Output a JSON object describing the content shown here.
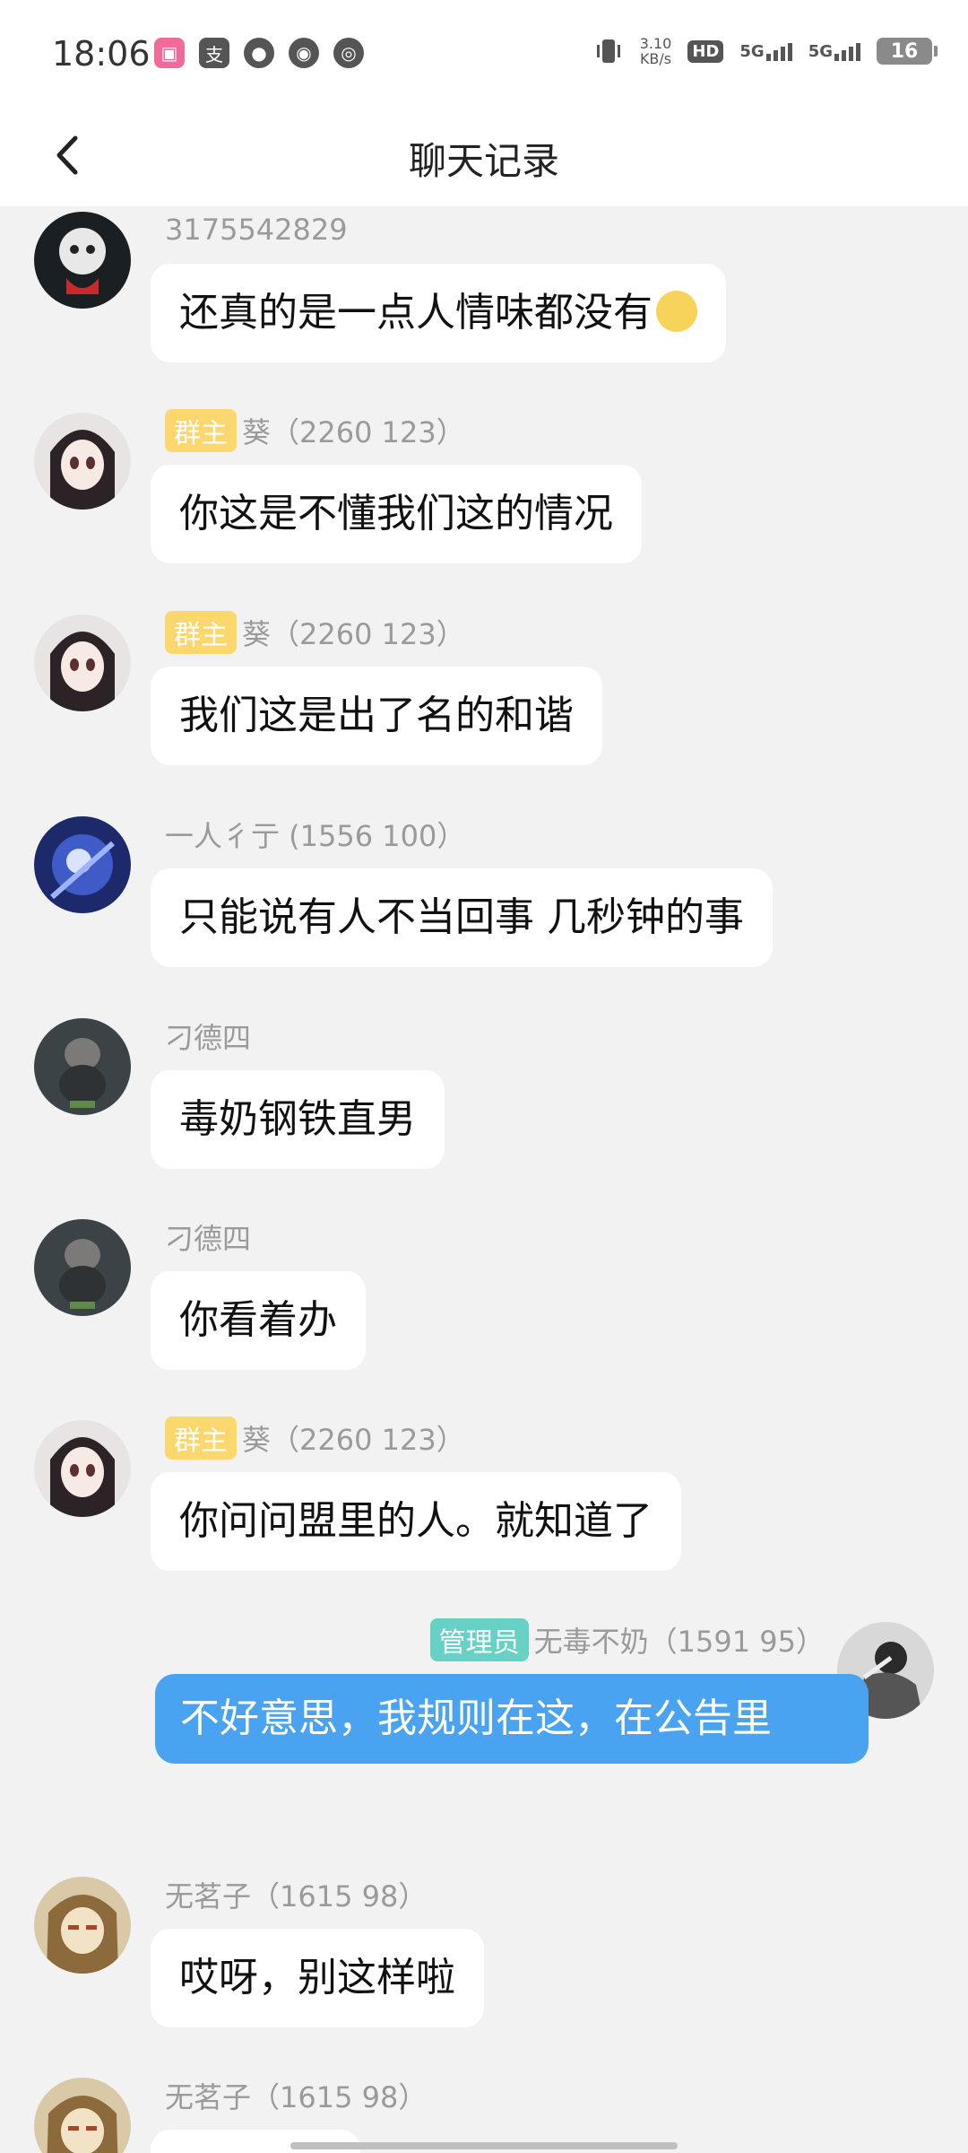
{
  "status_bar": {
    "time": "18:06",
    "net_speed_value": "3.10",
    "net_speed_unit": "KB/s",
    "hd_label": "HD",
    "signal_label_1": "5G",
    "signal_label_2": "5G",
    "battery": "16"
  },
  "header": {
    "title": "聊天记录"
  },
  "messages": [
    {
      "sender": "3175542829",
      "text": "还真的是一点人情味都没有"
    },
    {
      "badge": "群主",
      "sender": "葵（2260 123）",
      "text": "你这是不懂我们这的情况"
    },
    {
      "badge": "群主",
      "sender": "葵（2260 123）",
      "text": "我们这是出了名的和谐"
    },
    {
      "sender": "一人彳亍 (1556  100）",
      "text": "只能说有人不当回事 几秒钟的事"
    },
    {
      "sender": "刁德四",
      "text": "毒奶钢铁直男"
    },
    {
      "sender": "刁德四",
      "text": "你看着办"
    },
    {
      "badge": "群主",
      "sender": "葵（2260 123）",
      "text": "你问问盟里的人。就知道了"
    },
    {
      "badge": "管理员",
      "sender": "无毒不奶（1591  95）",
      "text": "不好意思，我规则在这，在公告里"
    },
    {
      "sender": "无茗子（1615 98）",
      "text": "哎呀，别这样啦"
    },
    {
      "sender": "无茗子（1615 98）",
      "text": ""
    }
  ],
  "colors": {
    "background": "#f2f2f2",
    "self_bubble": "#4aa3f0",
    "owner_badge": "#fbd76e",
    "admin_badge": "#66d1c4"
  }
}
